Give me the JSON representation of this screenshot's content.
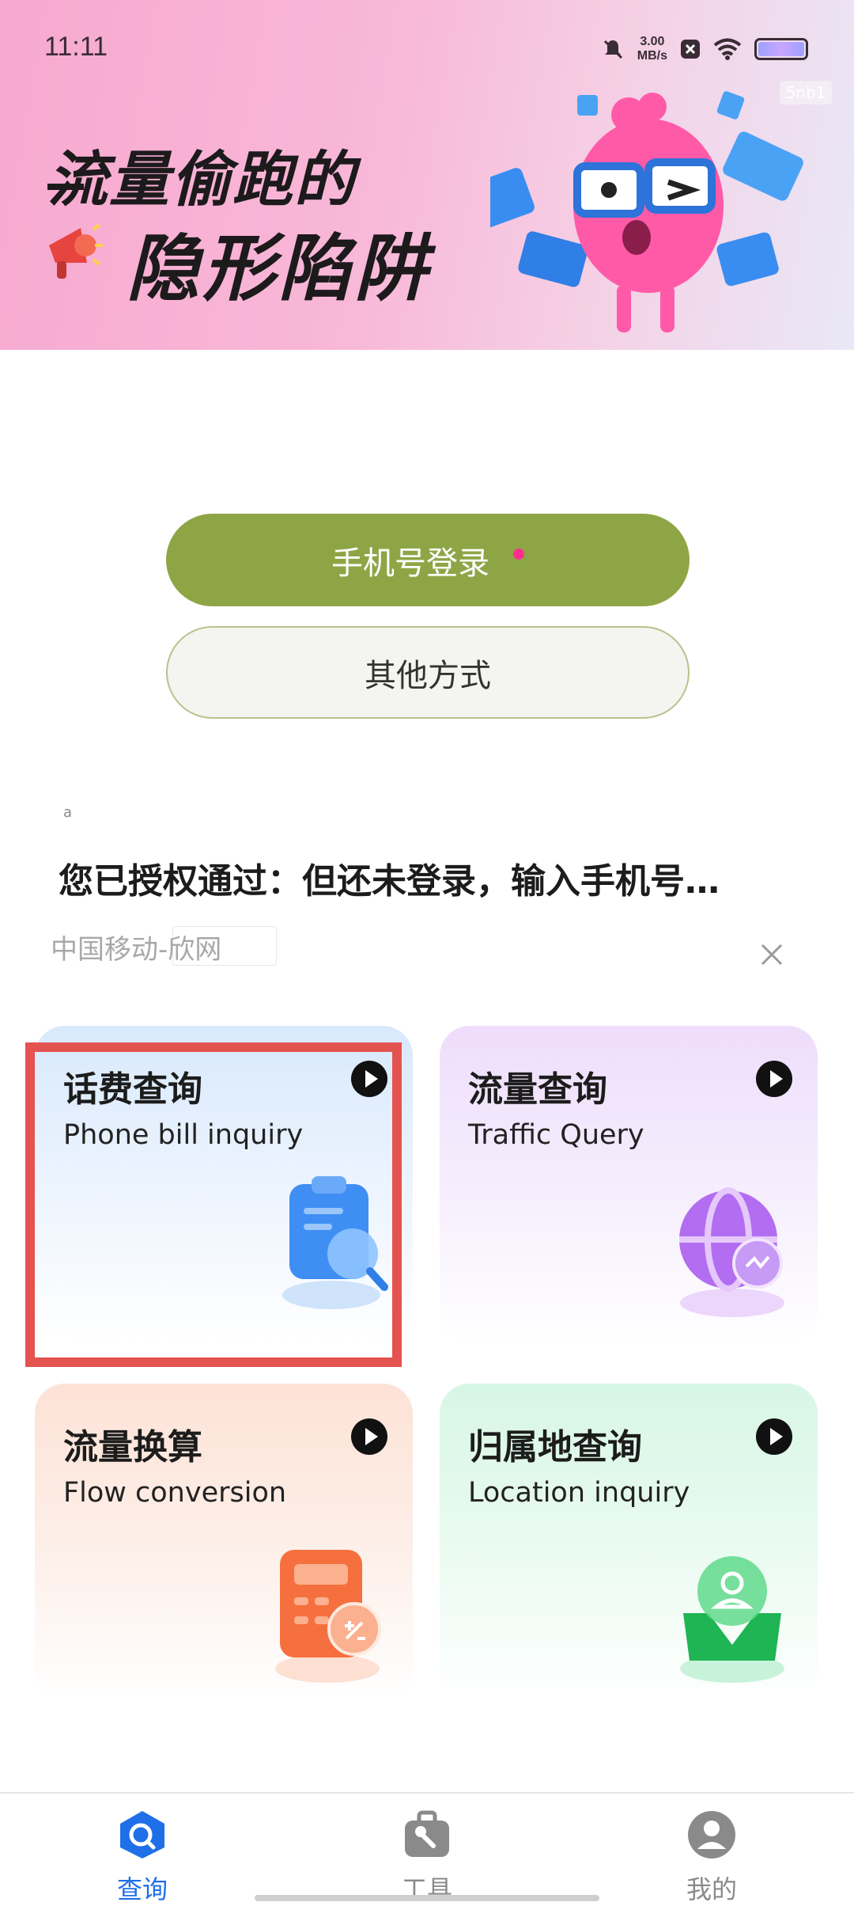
{
  "status_bar": {
    "time": "11:11",
    "speed_value": "3.00",
    "speed_unit": "MB/s"
  },
  "banner": {
    "tag": "5nb1",
    "headline_line1": "流量偷跑的",
    "headline_line2": "隐形陷阱"
  },
  "login": {
    "primary_label": "手机号登录",
    "secondary_label": "其他方式"
  },
  "ad": {
    "mark": "a",
    "notice": "您已授权通过：但还未登录，输入手机号…",
    "source": "中国移动-欣网",
    "close_icon": "close-icon"
  },
  "cards": [
    {
      "title": "话费查询",
      "subtitle": "Phone bill inquiry",
      "icon": "bill-search-icon",
      "color": "#3f8ef3"
    },
    {
      "title": "流量查询",
      "subtitle": "Traffic Query",
      "icon": "globe-icon",
      "color": "#b26df0"
    },
    {
      "title": "流量换算",
      "subtitle": "Flow conversion",
      "icon": "calculator-icon",
      "color": "#f5703e"
    },
    {
      "title": "归属地查询",
      "subtitle": "Location inquiry",
      "icon": "location-pin-icon",
      "color": "#27c260"
    }
  ],
  "nav": {
    "items": [
      {
        "label": "查询",
        "active": true
      },
      {
        "label": "工具",
        "active": false
      },
      {
        "label": "我的",
        "active": false
      }
    ],
    "active_color": "#1f6fe8",
    "inactive_color": "#8a8a8a"
  }
}
